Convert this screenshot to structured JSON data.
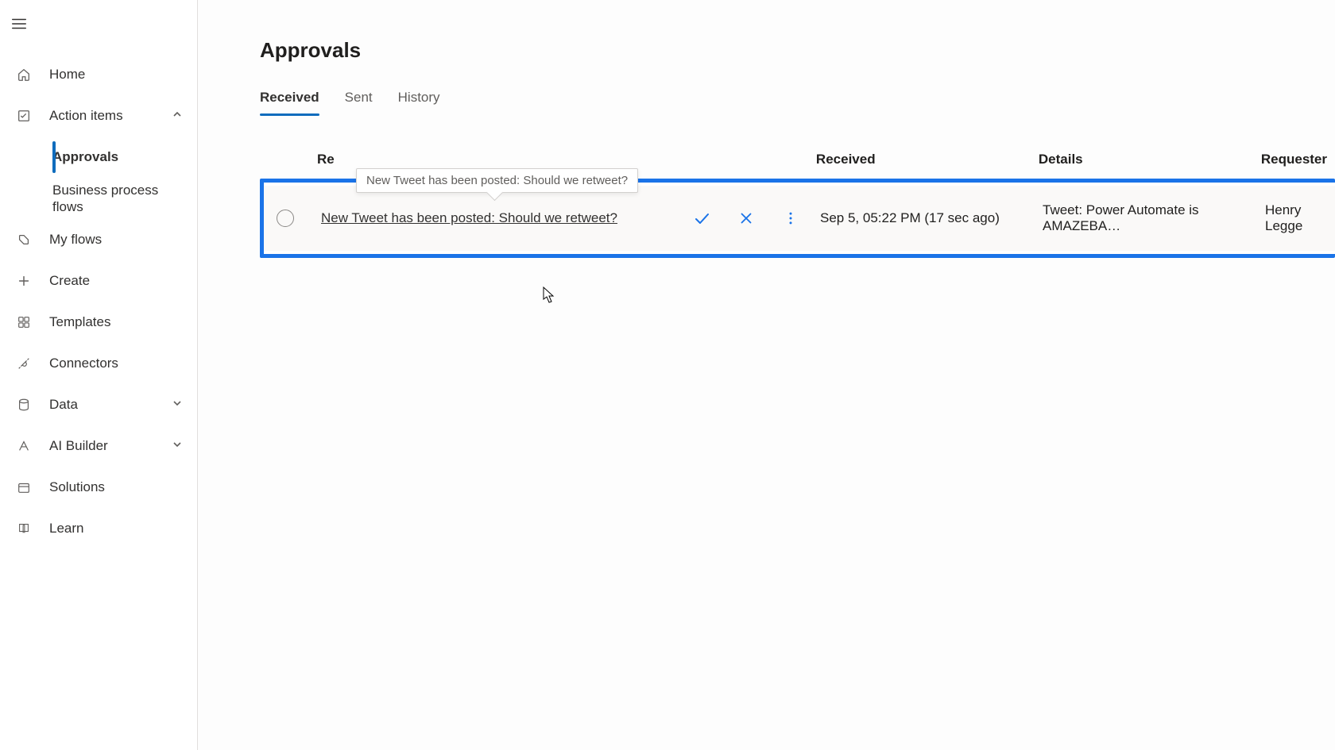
{
  "sidebar": {
    "items": [
      {
        "label": "Home"
      },
      {
        "label": "Action items",
        "expanded": true,
        "children": [
          {
            "label": "Approvals",
            "active": true
          },
          {
            "label": "Business process flows"
          }
        ]
      },
      {
        "label": "My flows"
      },
      {
        "label": "Create"
      },
      {
        "label": "Templates"
      },
      {
        "label": "Connectors"
      },
      {
        "label": "Data",
        "chevron": "down"
      },
      {
        "label": "AI Builder",
        "chevron": "down"
      },
      {
        "label": "Solutions"
      },
      {
        "label": "Learn"
      }
    ]
  },
  "page": {
    "title": "Approvals",
    "tabs": [
      {
        "label": "Received",
        "active": true
      },
      {
        "label": "Sent"
      },
      {
        "label": "History"
      }
    ]
  },
  "table": {
    "headers": {
      "request": "Re",
      "received": "Received",
      "details": "Details",
      "requester": "Requester"
    },
    "rows": [
      {
        "request": "New Tweet has been posted: Should we retweet?",
        "received": "Sep 5, 05:22 PM (17 sec ago)",
        "details": "Tweet: Power Automate is AMAZEBA…",
        "requester": "Henry Legge"
      }
    ],
    "tooltip": "New Tweet has been posted: Should we retweet?"
  }
}
